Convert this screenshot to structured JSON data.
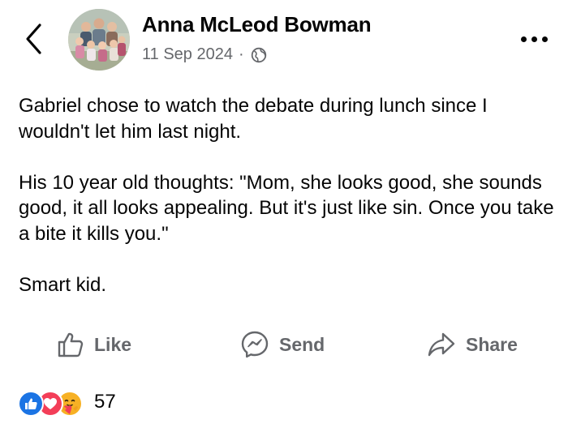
{
  "header": {
    "back_icon": "chevron-left-icon",
    "author_name": "Anna McLeod Bowman",
    "date": "11 Sep 2024",
    "separator": "·",
    "audience_icon": "globe-icon",
    "more_icon": "more-horizontal-icon"
  },
  "post": {
    "paragraphs": [
      "Gabriel chose to watch the debate during lunch since I wouldn't let him last night.",
      "His 10 year old thoughts: \"Mom, she looks good, she sounds good, it all looks appealing. But it's just like sin. Once you take a bite it kills you.\"",
      "Smart kid."
    ]
  },
  "actions": {
    "like": {
      "label": "Like",
      "icon": "thumbs-up-icon"
    },
    "send": {
      "label": "Send",
      "icon": "messenger-icon"
    },
    "share": {
      "label": "Share",
      "icon": "share-arrow-icon"
    }
  },
  "reactions": {
    "icons": [
      "like-reaction-icon",
      "love-reaction-icon",
      "care-reaction-icon"
    ],
    "count": "57"
  },
  "colors": {
    "text_primary": "#050505",
    "text_secondary": "#65676b",
    "like_blue": "#1b74e4",
    "love_red": "#f33e58",
    "care_yellow": "#f7b125"
  }
}
